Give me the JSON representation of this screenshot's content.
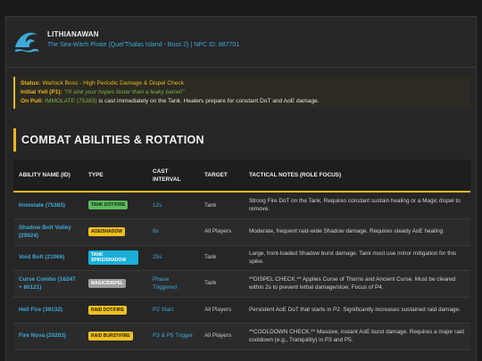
{
  "header": {
    "npc_name": "LITHIANAWAN",
    "subtitle": "The Sea-Witch Pirate (Quel'Thalas Island - Boss 2) | NPC ID: 887701",
    "logo_icon": "wave-crest-icon"
  },
  "info": {
    "status_label": "Status:",
    "status_value": "Warlock Boss - High Periodic Damage & Dispel Check",
    "yell_label": "Initial Yell (P1):",
    "yell_value": "\"I'll sink your hopes faster than a leaky barrel!\"",
    "pull_label": "On Pull:",
    "pull_spell": "IMMOLATE (75383)",
    "pull_text": " is cast immediately on the Tank. Healers prepare for constant DoT and AoE damage."
  },
  "section_title": "COMBAT ABILITIES & ROTATION",
  "table": {
    "headers": {
      "name": "ABILITY NAME (ID)",
      "type": "TYPE",
      "interval": "CAST INTERVAL",
      "target": "TARGET",
      "notes": "TACTICAL NOTES (ROLE FOCUS)"
    },
    "rows": [
      {
        "name": "Immolate (75383)",
        "type": "TANK DOT/FIRE",
        "interval": "12s",
        "target": "Tank",
        "notes": "Strong Fire DoT on the Tank. Requires constant sustain healing or a Magic dispel to remove."
      },
      {
        "name": "Shadow Bolt Volley (29924)",
        "type": "AOE/SHADOW",
        "interval": "8s",
        "target": "All Players",
        "notes": "Moderate, frequent raid-wide Shadow damage. Requires steady AoE healing."
      },
      {
        "name": "Void Bolt (21066)",
        "type": "TANK SPIKE/SHADOW",
        "interval": "25s",
        "target": "Tank",
        "notes": "Large, front-loaded Shadow burst damage. Tank must use minor mitigation for this spike."
      },
      {
        "name": "Curse Combo (16247 + 60121)",
        "type": "MAGIC/DISPEL",
        "interval": "Phase Triggered",
        "target": "Tank",
        "notes": "**DISPEL CHECK.** Applies Curse of Thorns and Ancient Curse. Must be cleared within 2s to prevent lethal damage/slow. Focus of P4."
      },
      {
        "name": "Hell Fire (39132)",
        "type": "RAID DOT/FIRE",
        "interval": "P2 Start",
        "target": "All Players",
        "notes": "Persistent AoE DoT that starts in P2. Significantly increases sustained raid damage."
      },
      {
        "name": "Fire Nova (20203)",
        "type": "RAID BURST/FIRE",
        "interval": "P3 & P5 Trigger",
        "target": "All Players",
        "notes": "**COOLDOWN CHECK.** Massive, instant AoE burst damage. Requires a major raid cooldown (e.g., Tranquility) in P3 and P5."
      }
    ]
  },
  "colors": {
    "accent_gold": "#e8b820",
    "link_blue": "#3fa9d8",
    "badge_tank_dot": "#5cb85c",
    "badge_aoe_shadow": "#f0c020",
    "badge_tank_spike": "#1ab0d8",
    "badge_magic": "#9e9e9e",
    "badge_raid_dot": "#f0c020",
    "badge_raid_burst": "#f0c020"
  }
}
